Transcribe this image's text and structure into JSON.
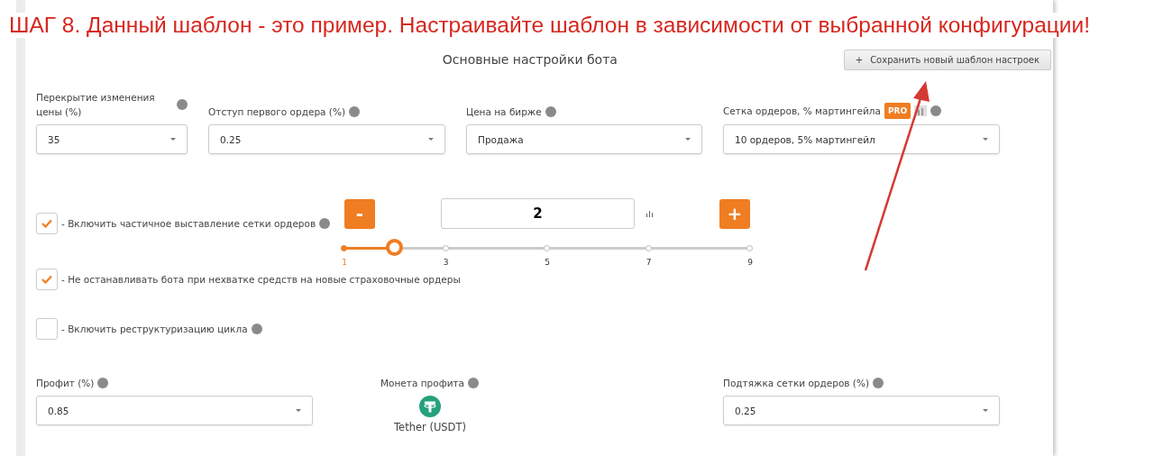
{
  "annotation": {
    "text": "ШАГ 8. Данный шаблон - это пример. Настраивайте шаблон в зависимости от выбранной конфигурации!"
  },
  "panel": {
    "title": "Основные настройки бота",
    "save_button": {
      "icon": "+",
      "label": "Сохранить новый шаблон настроек"
    }
  },
  "top_fields": [
    {
      "label": "Перекрытие изменения цены (%)",
      "value": "35"
    },
    {
      "label": "Отступ первого ордера (%)",
      "value": "0.25"
    },
    {
      "label": "Цена на бирже",
      "value": "Продажа"
    },
    {
      "label": "Сетка ордеров, % мартингейла",
      "badge": "PRO",
      "value": "10 ордеров, 5% мартингейл"
    }
  ],
  "checkboxes": [
    {
      "label": "- Включить частичное выставление сетки ордеров",
      "checked": true,
      "help": true
    },
    {
      "label": "- Не останавливать бота при нехватке средств на новые страховочные ордеры",
      "checked": true,
      "help": false
    },
    {
      "label": "- Включить реструктуризацию цикла",
      "checked": false,
      "help": true
    }
  ],
  "stepper": {
    "minus": "-",
    "value": "2",
    "plus": "+",
    "level": 0.125,
    "ticks": [
      "1",
      "3",
      "5",
      "7",
      "9"
    ]
  },
  "bottom": {
    "profit": {
      "label": "Профит (%)",
      "value": "0.85"
    },
    "coin": {
      "label": "Монета профита",
      "name": "Tether (USDT)"
    },
    "pullup": {
      "label": "Подтяжка сетки ордеров (%)",
      "value": "0.25"
    }
  }
}
